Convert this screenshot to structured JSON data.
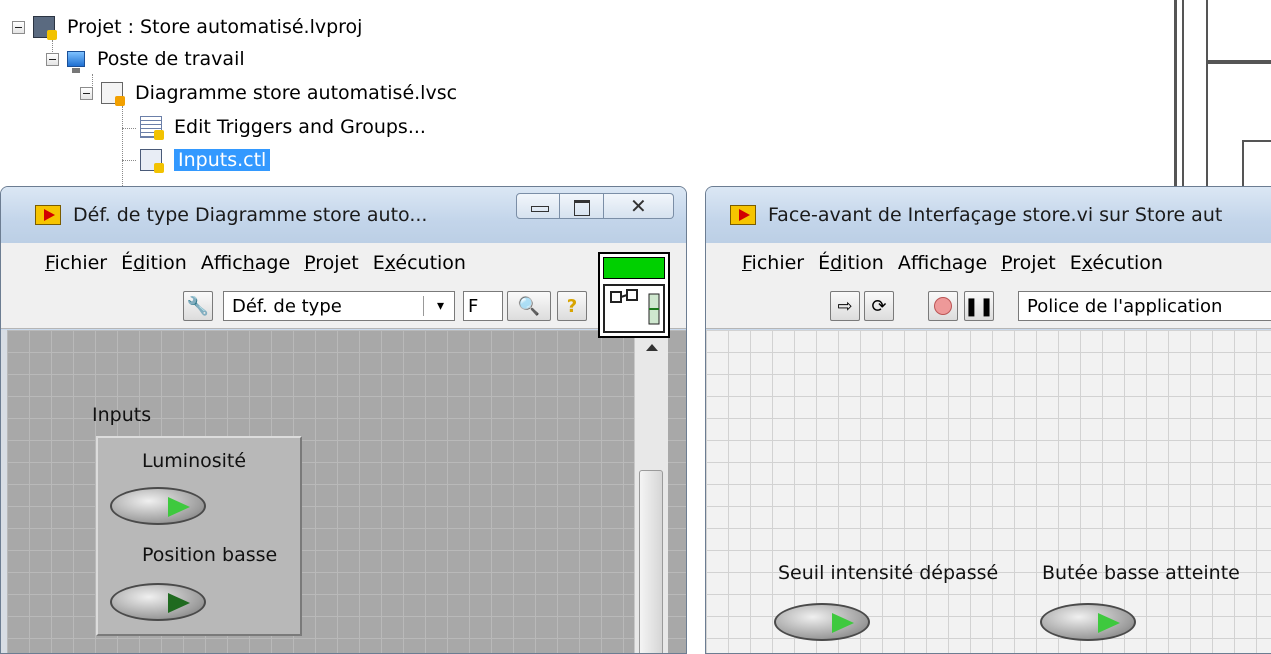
{
  "tree": {
    "items": [
      {
        "label": "Projet : Store automatisé.lvproj",
        "icon": "project-icon"
      },
      {
        "label": "Poste de travail",
        "icon": "computer-icon"
      },
      {
        "label": "Diagramme store automatisé.lvsc",
        "icon": "statechart-icon"
      },
      {
        "label": "Edit Triggers and Groups...",
        "icon": "edit-triggers-icon"
      },
      {
        "label": "Inputs.ctl",
        "icon": "control-file-icon",
        "selected": true
      }
    ]
  },
  "left_window": {
    "title": "Déf. de type Diagramme store auto...",
    "menu": [
      "Fichier",
      "Édition",
      "Affichage",
      "Projet",
      "Exécution"
    ],
    "menu_mnemonics": [
      "F",
      "d",
      "h",
      "P",
      "x"
    ],
    "toolbar": {
      "wrench": "wrench-icon",
      "select_value": "Déf. de type",
      "font_select_value": "F",
      "search": "search-icon",
      "help": "?"
    },
    "panel": {
      "cluster_title": "Inputs",
      "leds": [
        {
          "label": "Luminosité",
          "state": "on"
        },
        {
          "label": "Position basse",
          "state": "off"
        }
      ]
    }
  },
  "right_window": {
    "title": "Face-avant de Interfaçage store.vi sur Store aut",
    "menu": [
      "Fichier",
      "Édition",
      "Affichage",
      "Projet",
      "Exécution"
    ],
    "toolbar": {
      "font_select_value": "Police de l'application"
    },
    "panel": {
      "leds": [
        {
          "label": "Seuil intensité dépassé",
          "state": "on"
        },
        {
          "label": "Butée basse atteinte",
          "state": "on"
        }
      ]
    }
  },
  "colors": {
    "selection": "#3399ff",
    "led_on": "#3ec93e",
    "led_off": "#1f6a1f",
    "icon_green": "#00d000"
  }
}
